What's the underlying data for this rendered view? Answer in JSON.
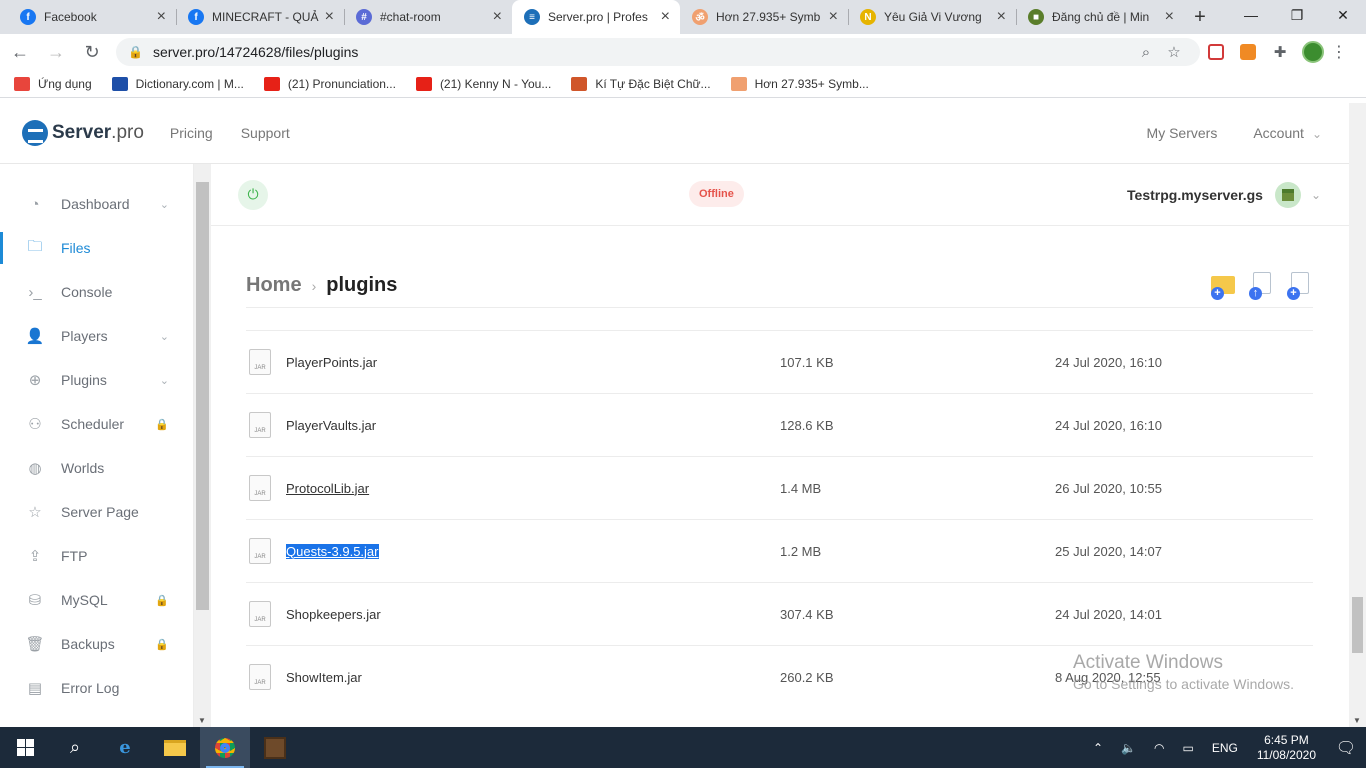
{
  "browser": {
    "tabs": [
      {
        "title": "Facebook",
        "icon": "facebook-icon",
        "color": "#1877f2",
        "glyph": "f"
      },
      {
        "title": "MINECRAFT - QUẢ",
        "icon": "facebook-icon",
        "color": "#1877f2",
        "glyph": "f"
      },
      {
        "title": "#chat-room",
        "icon": "chat-icon",
        "color": "#5b6bd6",
        "glyph": "#"
      },
      {
        "title": "Server.pro | Profes",
        "icon": "serverpro-icon",
        "color": "#1d6fb8",
        "glyph": "≡"
      },
      {
        "title": "Hơn 27.935+ Symb",
        "icon": "symbol-icon",
        "color": "#f0a070",
        "glyph": "ॐ"
      },
      {
        "title": "Yêu Giả Vi Vương",
        "icon": "n-icon",
        "color": "#e6b400",
        "glyph": "N"
      },
      {
        "title": "Đăng chủ đề | Min",
        "icon": "minecraft-icon",
        "color": "#5a7d2a",
        "glyph": "■"
      }
    ],
    "url": "server.pro/14724628/files/plugins",
    "bookmarks": [
      {
        "label": "Ứng dụng",
        "color": "#e8453c"
      },
      {
        "label": "Dictionary.com | M...",
        "color": "#1e4fa8"
      },
      {
        "label": "(21) Pronunciation...",
        "color": "#e62117"
      },
      {
        "label": "(21) Kenny N - You...",
        "color": "#e62117"
      },
      {
        "label": "Kí Tự Đặc Biệt Chữ...",
        "color": "#d0562a"
      },
      {
        "label": "Hơn 27.935+ Symb...",
        "color": "#f0a070"
      }
    ]
  },
  "site": {
    "brand_bold": "Server",
    "brand_rest": ".pro",
    "nav": [
      "Pricing",
      "Support"
    ],
    "right_nav": [
      "My Servers",
      "Account"
    ]
  },
  "sidebar": {
    "items": [
      {
        "label": "Dashboard",
        "icon": "gauge-icon",
        "glyph": "◔",
        "chevron": true,
        "locked": false,
        "active": false
      },
      {
        "label": "Files",
        "icon": "folder-icon",
        "glyph": "🗀",
        "chevron": false,
        "locked": false,
        "active": true
      },
      {
        "label": "Console",
        "icon": "terminal-icon",
        "glyph": "›_",
        "chevron": false,
        "locked": false,
        "active": false
      },
      {
        "label": "Players",
        "icon": "user-icon",
        "glyph": "👤",
        "chevron": true,
        "locked": false,
        "active": false
      },
      {
        "label": "Plugins",
        "icon": "plugin-icon",
        "glyph": "⊕",
        "chevron": true,
        "locked": false,
        "active": false
      },
      {
        "label": "Scheduler",
        "icon": "scheduler-icon",
        "glyph": "⚇",
        "chevron": false,
        "locked": true,
        "active": false
      },
      {
        "label": "Worlds",
        "icon": "globe-icon",
        "glyph": "◍",
        "chevron": false,
        "locked": false,
        "active": false
      },
      {
        "label": "Server Page",
        "icon": "star-icon",
        "glyph": "☆",
        "chevron": false,
        "locked": false,
        "active": false
      },
      {
        "label": "FTP",
        "icon": "upload-icon",
        "glyph": "⇪",
        "chevron": false,
        "locked": false,
        "active": false
      },
      {
        "label": "MySQL",
        "icon": "database-icon",
        "glyph": "⛁",
        "chevron": false,
        "locked": true,
        "active": false
      },
      {
        "label": "Backups",
        "icon": "trash-icon",
        "glyph": "🗑",
        "chevron": false,
        "locked": true,
        "active": false
      },
      {
        "label": "Error Log",
        "icon": "log-icon",
        "glyph": "▤",
        "chevron": false,
        "locked": false,
        "active": false
      }
    ]
  },
  "server": {
    "status": "Offline",
    "name": "Testrpg.myserver.gs"
  },
  "breadcrumb": {
    "home": "Home",
    "current": "plugins"
  },
  "files": [
    {
      "name": "PlayerPoints.jar",
      "size": "107.1 KB",
      "date": "24 Jul 2020, 16:10",
      "style": ""
    },
    {
      "name": "PlayerVaults.jar",
      "size": "128.6 KB",
      "date": "24 Jul 2020, 16:10",
      "style": ""
    },
    {
      "name": "ProtocolLib.jar",
      "size": "1.4 MB",
      "date": "26 Jul 2020, 10:55",
      "style": "underline"
    },
    {
      "name": "Quests-3.9.5.jar",
      "size": "1.2 MB",
      "date": "25 Jul 2020, 14:07",
      "style": "selected"
    },
    {
      "name": "Shopkeepers.jar",
      "size": "307.4 KB",
      "date": "24 Jul 2020, 14:01",
      "style": ""
    },
    {
      "name": "ShowItem.jar",
      "size": "260.2 KB",
      "date": "8 Aug 2020, 12:55",
      "style": ""
    }
  ],
  "file_icon_label": "JAR",
  "watermark": {
    "line1": "Activate Windows",
    "line2": "Go to Settings to activate Windows."
  },
  "taskbar": {
    "language": "ENG",
    "time": "6:45 PM",
    "date": "11/08/2020"
  }
}
